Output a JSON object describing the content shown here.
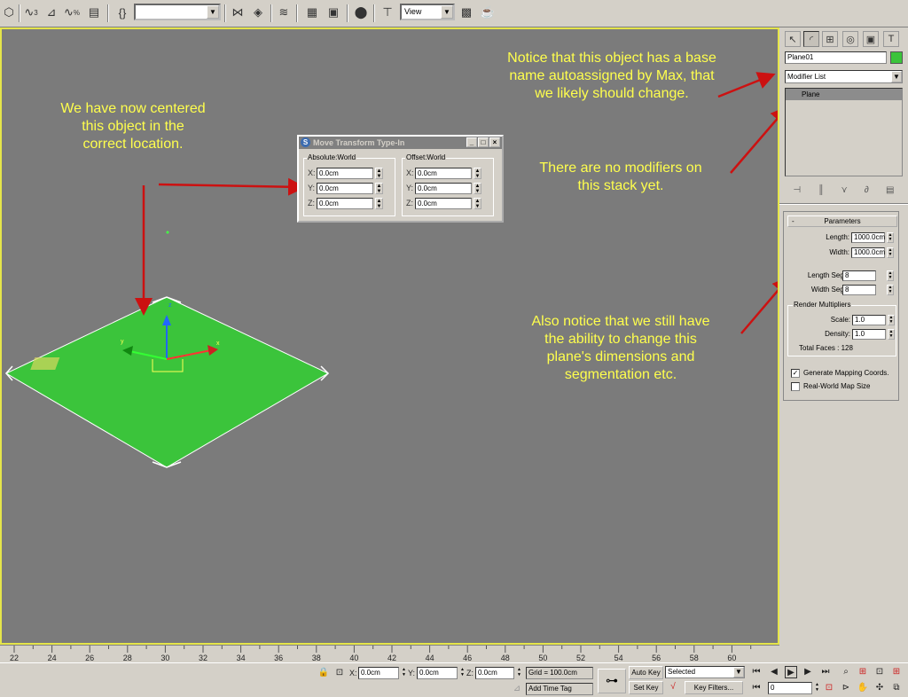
{
  "toolbar": {
    "named_selection_value": "",
    "ref_coord_value": "View",
    "icons": [
      "select-icon",
      "snap-3d-icon",
      "angle-snap-icon",
      "percent-snap-icon",
      "spinner-snap-icon",
      "edit-named-selection-icon",
      "mirror-icon",
      "align-icon",
      "layer-manager-icon",
      "curve-editor-icon",
      "schematic-view-icon",
      "material-editor-icon",
      "render-setup-icon",
      "render-frame-icon",
      "quick-render-icon"
    ],
    "snap_label": "3",
    "percent_label": "%"
  },
  "viewport": {
    "notes": {
      "centered": "We have now centered\nthis object in the\ncorrect location.",
      "base_name": "Notice that this object has a base\nname autoassigned by Max, that\nwe likely should change.",
      "no_modifiers": "There are no modifiers on\nthis stack yet.",
      "dimensions": "Also notice that we still have\nthe ability to change this\nplane's dimensions and\nsegmentation etc."
    },
    "gizmo_labels": {
      "z": "z",
      "x": "x",
      "y": "y"
    },
    "accent_color": "#ffff4d",
    "plane_color": "#3bc43b"
  },
  "typein": {
    "title": "Move Transform Type-In",
    "absolute": {
      "legend": "Absolute:World",
      "rows": [
        {
          "axis": "X:",
          "value": "0.0cm"
        },
        {
          "axis": "Y:",
          "value": "0.0cm"
        },
        {
          "axis": "Z:",
          "value": "0.0cm"
        }
      ]
    },
    "offset": {
      "legend": "Offset:World",
      "rows": [
        {
          "axis": "X:",
          "value": "0.0cm"
        },
        {
          "axis": "Y:",
          "value": "0.0cm"
        },
        {
          "axis": "Z:",
          "value": "0.0cm"
        }
      ]
    }
  },
  "command_panel": {
    "tabs": [
      "create-tab-icon",
      "modify-tab-icon",
      "hierarchy-tab-icon",
      "motion-tab-icon",
      "display-tab-icon",
      "utilities-tab-icon"
    ],
    "object_name": "Plane01",
    "object_color": "#3bc43b",
    "modifier_list": "Modifier List",
    "stack_items": [
      "Plane"
    ],
    "parameters": {
      "title": "Parameters",
      "collapse": "-",
      "length_label": "Length:",
      "length_value": "1000.0cm",
      "width_label": "Width:",
      "width_value": "1000.0cm",
      "length_segs_label": "Length Segs:",
      "length_segs_value": "8",
      "width_segs_label": "Width Segs:",
      "width_segs_value": "8",
      "render_multipliers": "Render Multipliers",
      "scale_label": "Scale:",
      "scale_value": "1.0",
      "density_label": "Density:",
      "density_value": "1.0",
      "total_faces": "Total Faces : 128",
      "gen_mapping": "Generate Mapping Coords.",
      "gen_mapping_checked": true,
      "real_world": "Real-World Map Size",
      "real_world_checked": false
    }
  },
  "timeline": {
    "ticks": [
      "22",
      "24",
      "26",
      "28",
      "30",
      "32",
      "34",
      "36",
      "38",
      "40",
      "42",
      "44",
      "46",
      "48",
      "50",
      "52",
      "54",
      "56",
      "58",
      "60"
    ]
  },
  "statusbar": {
    "x_label": "X:",
    "x_value": "0.0cm",
    "y_label": "Y:",
    "y_value": "0.0cm",
    "z_label": "Z:",
    "z_value": "0.0cm",
    "grid": "Grid = 100.0cm",
    "add_time_tag": "Add Time Tag",
    "auto_key": "Auto Key",
    "selected": "Selected",
    "set_key": "Set Key",
    "key_filters": "Key Filters...",
    "frame": "0"
  }
}
